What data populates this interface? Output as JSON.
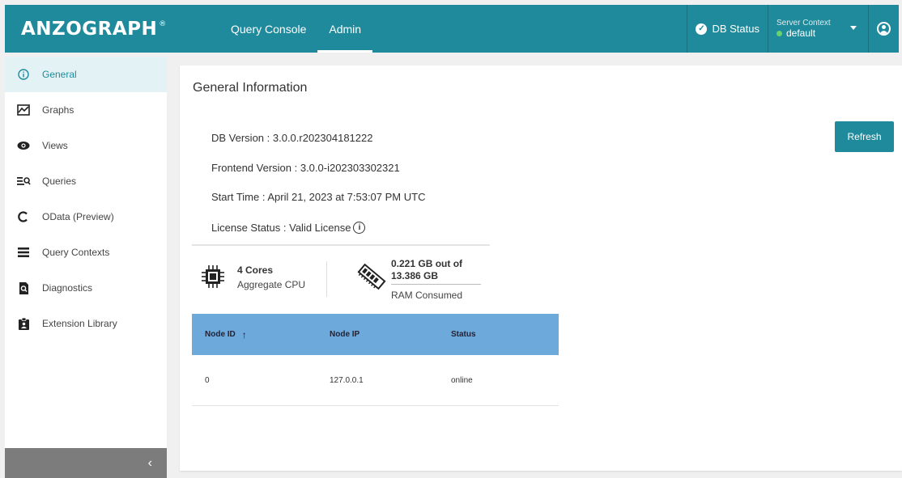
{
  "header": {
    "logo": "ANZOGRAPH",
    "logo_mark": "®",
    "tabs": [
      {
        "label": "Query Console"
      },
      {
        "label": "Admin"
      }
    ],
    "db_status": "DB Status",
    "server_context_label": "Server Context",
    "server_context_value": "default"
  },
  "sidebar": {
    "items": [
      {
        "label": "General",
        "icon": "info-icon"
      },
      {
        "label": "Graphs",
        "icon": "graph-icon"
      },
      {
        "label": "Views",
        "icon": "eye-icon"
      },
      {
        "label": "Queries",
        "icon": "query-search-icon"
      },
      {
        "label": "OData (Preview)",
        "icon": "odata-icon"
      },
      {
        "label": "Query Contexts",
        "icon": "list-icon"
      },
      {
        "label": "Diagnostics",
        "icon": "diagnostics-icon"
      },
      {
        "label": "Extension Library",
        "icon": "clipboard-icon"
      }
    ],
    "collapse": "‹"
  },
  "main": {
    "title": "General Information",
    "refresh_label": "Refresh",
    "db_version": "DB Version : 3.0.0.r202304181222",
    "frontend_version": "Frontend Version : 3.0.0-i202303302321",
    "start_time": "Start Time : April 21, 2023 at 7:53:07 PM UTC",
    "license_status": "License Status : Valid License",
    "cpu_cores": "4 Cores",
    "cpu_label": "Aggregate CPU",
    "ram_value": "0.221 GB out of 13.386 GB",
    "ram_label": "RAM Consumed",
    "table": {
      "headers": [
        "Node ID",
        "Node IP",
        "Status"
      ],
      "rows": [
        [
          "0",
          "127.0.0.1",
          "online"
        ]
      ]
    }
  },
  "colors": {
    "primary": "#1e8a9b",
    "table_header": "#6ea9dc",
    "status_online": "#67d36d",
    "collapse_bar": "#7c7c7c"
  }
}
